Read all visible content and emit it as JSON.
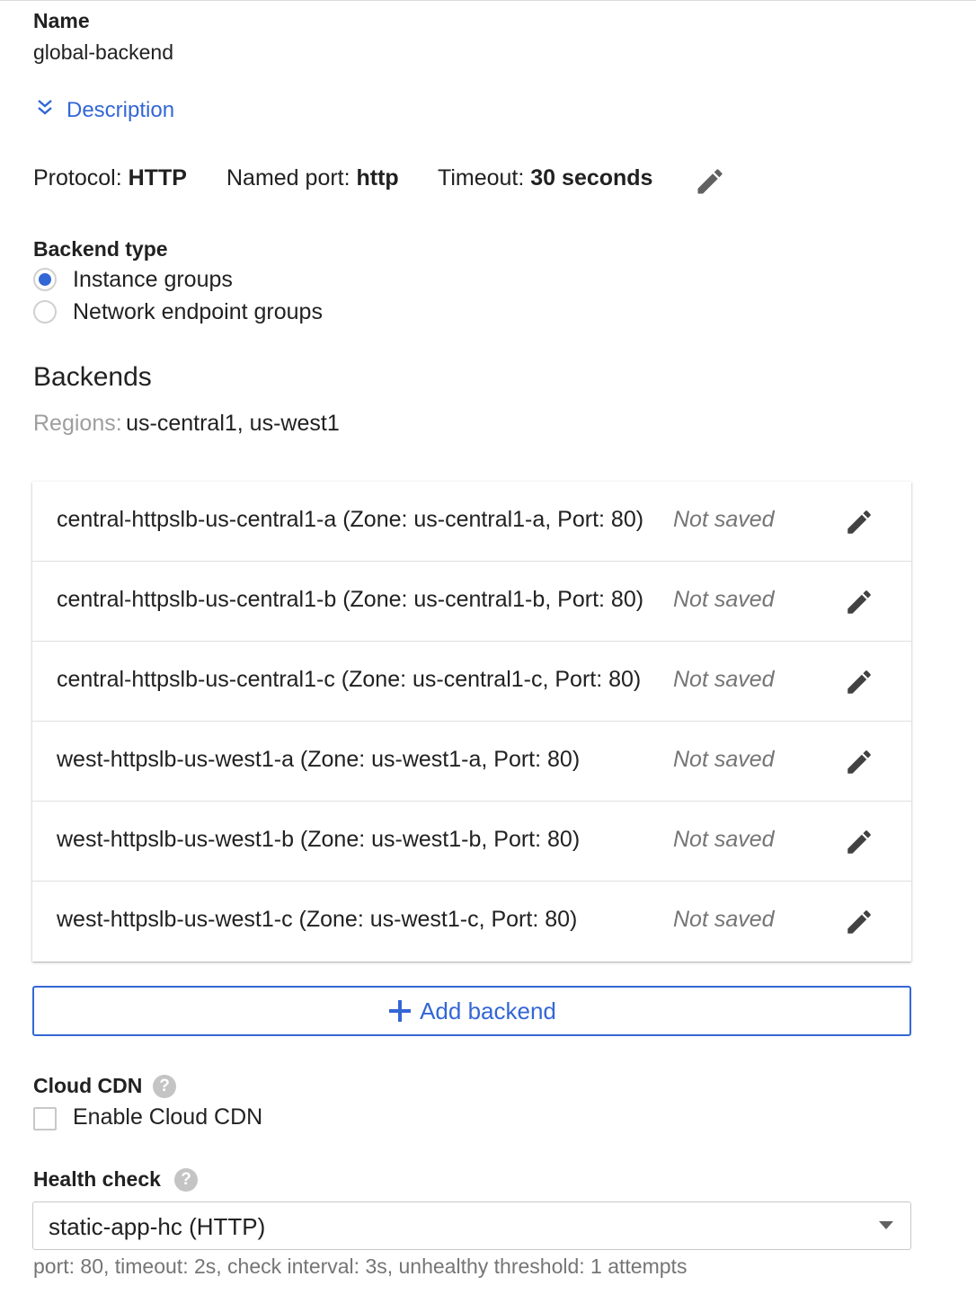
{
  "name": {
    "label": "Name",
    "value": "global-backend"
  },
  "description_toggle": {
    "label": "Description",
    "icon": "chevron-double-down-icon"
  },
  "settings": {
    "protocol_key": "Protocol:",
    "protocol_val": "HTTP",
    "named_port_key": "Named port:",
    "named_port_val": "http",
    "timeout_key": "Timeout:",
    "timeout_val": "30 seconds",
    "edit_icon": "pencil-icon"
  },
  "backend_type": {
    "label": "Backend type",
    "options": [
      {
        "label": "Instance groups",
        "selected": true
      },
      {
        "label": "Network endpoint groups",
        "selected": false
      }
    ]
  },
  "backends": {
    "title": "Backends",
    "regions_key": "Regions:",
    "regions_val": "us-central1, us-west1",
    "rows": [
      {
        "text": "central-httpslb-us-central1-a (Zone: us-central1-a, Port: 80)",
        "status": "Not saved"
      },
      {
        "text": "central-httpslb-us-central1-b (Zone: us-central1-b, Port: 80)",
        "status": "Not saved"
      },
      {
        "text": "central-httpslb-us-central1-c (Zone: us-central1-c, Port: 80)",
        "status": "Not saved"
      },
      {
        "text": "west-httpslb-us-west1-a (Zone: us-west1-a, Port: 80)",
        "status": "Not saved"
      },
      {
        "text": "west-httpslb-us-west1-b (Zone: us-west1-b, Port: 80)",
        "status": "Not saved"
      },
      {
        "text": "west-httpslb-us-west1-c (Zone: us-west1-c, Port: 80)",
        "status": "Not saved"
      }
    ],
    "add_label": "Add backend"
  },
  "cloud_cdn": {
    "label": "Cloud CDN",
    "help": "?",
    "checkbox_label": "Enable Cloud CDN",
    "checked": false
  },
  "health_check": {
    "label": "Health check",
    "help": "?",
    "selected": "static-app-hc (HTTP)",
    "details": "port: 80, timeout: 2s, check interval: 3s, unhealthy threshold: 1 attempts"
  },
  "colors": {
    "accent": "#3367d6",
    "muted": "#757575",
    "text": "#212121"
  }
}
